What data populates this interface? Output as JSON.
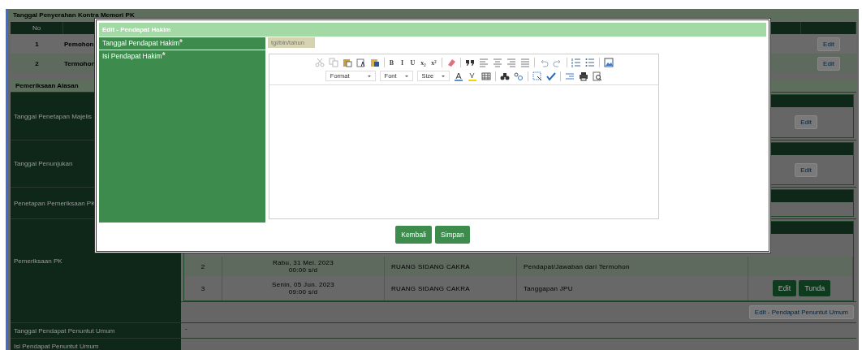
{
  "kontra_memori": {
    "title": "Tanggal Penyerahan Kontra Memori PK",
    "columns": [
      "No"
    ],
    "rows": [
      {
        "no": "1",
        "party": "Pemohon",
        "action": "Edit"
      },
      {
        "no": "2",
        "party": "Termohon",
        "action": "Edit"
      }
    ]
  },
  "pemeriksaan": {
    "title": "Pemeriksaan Alasan",
    "rows": [
      {
        "label": "Tanggal Penetapan Majelis",
        "kind": "edit_panel",
        "action": "Edit"
      },
      {
        "label": "Tanggal Penunjukan",
        "kind": "edit_panel",
        "action": "Edit"
      },
      {
        "label": "Penetapan Pemeriksaan PK",
        "kind": "panel"
      },
      {
        "label": "Pemeriksaan PK",
        "kind": "hearings",
        "hearings": [
          {
            "no": "2",
            "date": "Rabu, 31 Mei. 2023",
            "time": "00:00 s/d",
            "room": "RUANG SIDANG CAKRA",
            "agenda": "Pendapat/Jawaban dari Termohon"
          },
          {
            "no": "3",
            "date": "Senin, 05 Jun. 2023",
            "time": "09:00 s/d",
            "room": "RUANG SIDANG CAKRA",
            "agenda": "Tanggapan JPU",
            "actions": [
              "Edit",
              "Tunda"
            ]
          }
        ]
      },
      {
        "kind": "action",
        "action": "Edit - Pendapat Penuntut Umum"
      },
      {
        "label": "Tanggal Pendapat Penuntut Umum",
        "kind": "value",
        "value": "-"
      },
      {
        "label": "Isi Pendapat Penuntut Umum",
        "kind": "value"
      }
    ]
  },
  "modal": {
    "title": "Edit - Pendapat Hakim",
    "fields": [
      {
        "label": "Tanggal Pendapat Hakim",
        "required_mark": "*",
        "kind": "date",
        "placeholder": "tgl/bln/tahun"
      },
      {
        "label": "Isi Pendapat Hakim",
        "required_mark": "*",
        "kind": "editor"
      }
    ],
    "editor": {
      "format_buttons": [
        "B",
        "I",
        "U",
        "x₂",
        "x²"
      ],
      "dropdowns": [
        "Format",
        "Font",
        "Size"
      ]
    },
    "buttons": [
      "Kembali",
      "Simpan"
    ]
  }
}
